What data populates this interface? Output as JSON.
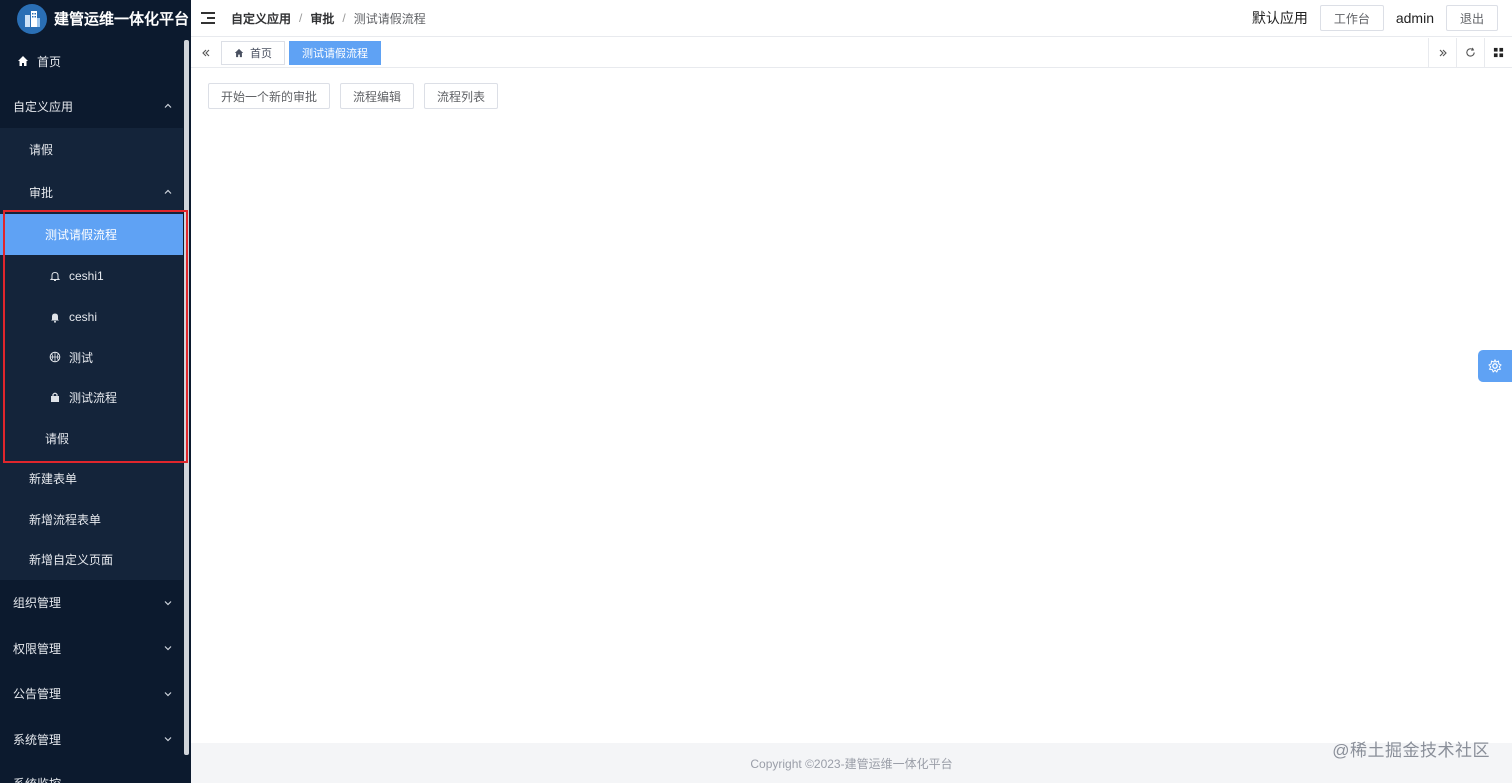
{
  "brand": {
    "title": "建管运维一体化平台",
    "logo_icon": "building-logo-icon"
  },
  "header": {
    "breadcrumbs": [
      "自定义应用",
      "审批",
      "测试请假流程"
    ],
    "app_name": "默认应用",
    "workbench_label": "工作台",
    "user_name": "admin",
    "logout_label": "退出"
  },
  "sidebar": {
    "home": "首页",
    "custom_apps": "自定义应用",
    "leave": "请假",
    "approval": "审批",
    "test_leave_flow": "测试请假流程",
    "ceshi1": "ceshi1",
    "ceshi": "ceshi",
    "test": "测试",
    "test_flow": "测试流程",
    "leave2": "请假",
    "new_form": "新建表单",
    "new_flow_form": "新增流程表单",
    "new_custom_page": "新增自定义页面",
    "org_mgmt": "组织管理",
    "perm_mgmt": "权限管理",
    "notice_mgmt": "公告管理",
    "system_mgmt": "系统管理",
    "system_monitor": "系统监控"
  },
  "tabs": {
    "home": "首页",
    "active": "测试请假流程"
  },
  "actions": {
    "start_approval": "开始一个新的审批",
    "flow_edit": "流程编辑",
    "flow_list": "流程列表"
  },
  "footer": {
    "copyright": "Copyright ©2023-建管运维一体化平台"
  },
  "watermark": "@稀土掘金技术社区",
  "colors": {
    "sidebar_bg": "#0c1a2e",
    "accent": "#5fa2f4",
    "highlight_border": "#e0262c"
  }
}
